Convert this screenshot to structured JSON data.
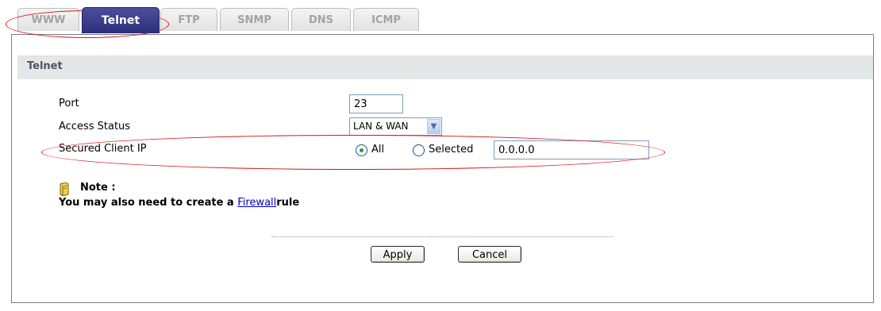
{
  "tabs": [
    {
      "label": "WWW",
      "active": false
    },
    {
      "label": "Telnet",
      "active": true
    },
    {
      "label": "FTP",
      "active": false
    },
    {
      "label": "SNMP",
      "active": false
    },
    {
      "label": "DNS",
      "active": false
    },
    {
      "label": "ICMP",
      "active": false
    }
  ],
  "section": {
    "title": "Telnet"
  },
  "form": {
    "port_label": "Port",
    "port_value": "23",
    "access_status_label": "Access Status",
    "access_status_value": "LAN & WAN",
    "secured_client_ip_label": "Secured Client IP",
    "radio_all_label": "All",
    "radio_selected_label": "Selected",
    "selected_radio": "All",
    "ip_value": "0.0.0.0"
  },
  "note": {
    "title": "Note :",
    "text_before": "You may also need to create a ",
    "link": "Firewall",
    "text_after": "rule"
  },
  "buttons": {
    "apply": "Apply",
    "cancel": "Cancel"
  },
  "colors": {
    "active_tab": "#2c2f7a",
    "inactive_tab_text": "#a3a3a3",
    "section_header_bg": "#e4e7e8",
    "link": "#0000cc",
    "annotation": "#dd1111",
    "radio_dot": "#21a121"
  },
  "icons": {
    "note": "note-book-icon",
    "dropdown": "chevron-down-icon"
  }
}
